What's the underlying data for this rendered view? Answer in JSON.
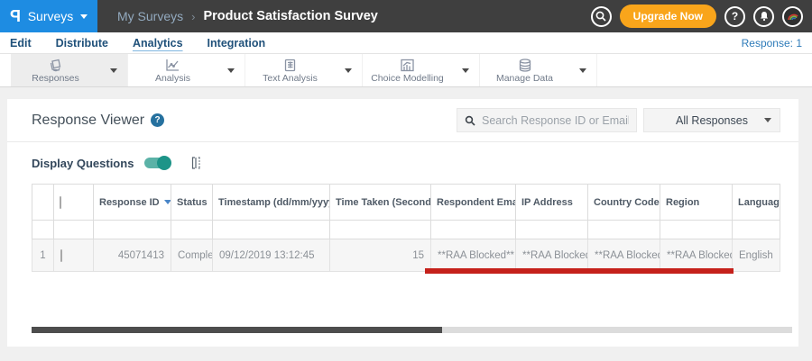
{
  "header": {
    "logo_glyph": "P",
    "product_menu": "Surveys",
    "breadcrumb": {
      "parent": "My Surveys",
      "separator": "›",
      "current": "Product Satisfaction Survey"
    },
    "upgrade_label": "Upgrade Now",
    "help_glyph": "?"
  },
  "subnav": {
    "items": [
      "Edit",
      "Distribute",
      "Analytics",
      "Integration"
    ],
    "active": "Analytics",
    "response_count": "Response: 1"
  },
  "toolbar": {
    "items": [
      {
        "label": "Responses",
        "icon": "responses-icon",
        "selected": true
      },
      {
        "label": "Analysis",
        "icon": "analysis-icon",
        "selected": false
      },
      {
        "label": "Text Analysis",
        "icon": "text-analysis-icon",
        "selected": false
      },
      {
        "label": "Choice Modelling",
        "icon": "choice-modelling-icon",
        "selected": false
      },
      {
        "label": "Manage Data",
        "icon": "manage-data-icon",
        "selected": false
      }
    ]
  },
  "viewer": {
    "title": "Response Viewer",
    "help_glyph": "?",
    "search_placeholder": "Search Response ID or Email",
    "filter_value": "All Responses",
    "display_questions_label": "Display Questions",
    "toggle_on": true
  },
  "table": {
    "columns": {
      "response_id": "Response ID",
      "status": "Status",
      "timestamp": "Timestamp (dd/mm/yyyy)",
      "time_taken": "Time Taken (Seconds)",
      "respondent_email": "Respondent Email",
      "ip_address": "IP Address",
      "country_code": "Country Code",
      "region": "Region",
      "language": "Language"
    },
    "rows": [
      {
        "index": "1",
        "response_id": "45071413",
        "status": "Completed",
        "timestamp": "09/12/2019 13:12:45",
        "time_taken": "15",
        "respondent_email": "**RAA Blocked**",
        "ip_address": "**RAA Blocked**",
        "country_code": "**RAA Blocked**",
        "region": "**RAA Blocked**",
        "language": "English"
      }
    ]
  },
  "colors": {
    "brand_blue": "#1e8ce2",
    "upgrade_orange": "#f9a51b",
    "toggle_teal": "#1d9488",
    "link_blue": "#4a86c8",
    "highlight_red": "#c5211b",
    "header_dark": "#3f3f3f"
  }
}
